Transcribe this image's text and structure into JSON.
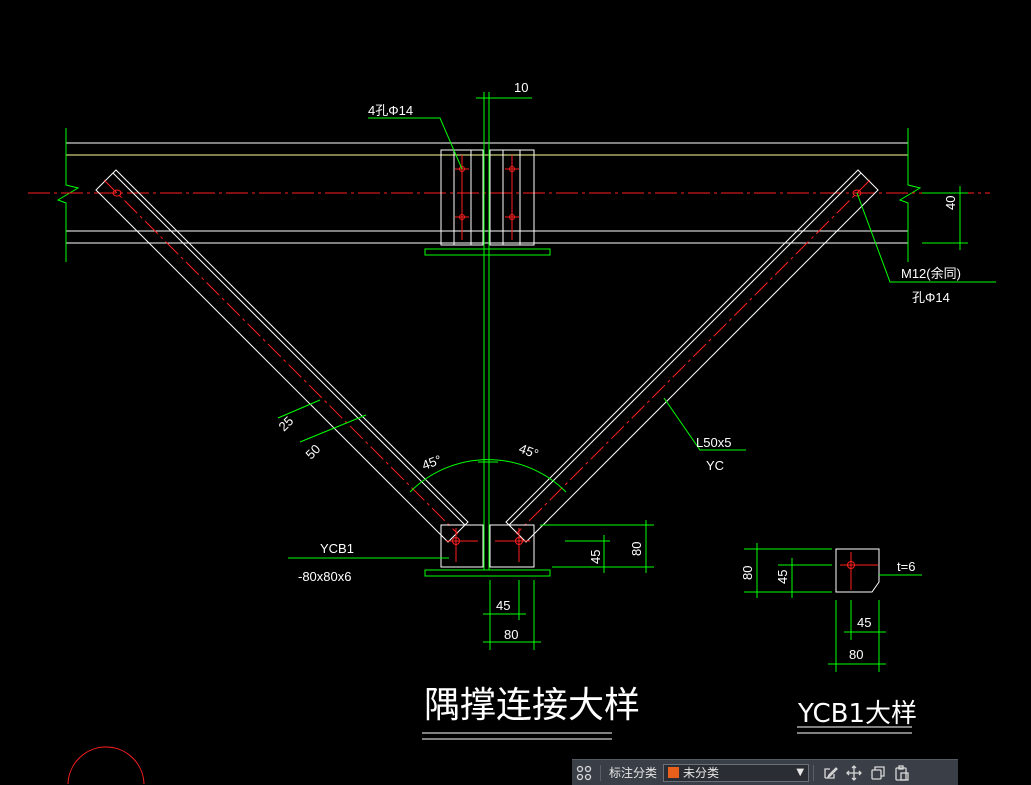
{
  "drawing": {
    "title_main": "隅撑连接大样",
    "title_detail": "YCB1大样",
    "labels": {
      "holes": "4孔Φ14",
      "gap": "10",
      "edge_40": "40",
      "bolt": "M12(余同)",
      "bolt_hole": "孔Φ14",
      "dim_25": "25",
      "dim_50": "50",
      "angle_left": "45°",
      "angle_right": "45°",
      "angle_section": "L50x5",
      "angle_code": "YC",
      "plate_code": "YCB1",
      "plate_size": "-80x80x6",
      "dim_45_v": "45",
      "dim_80_v": "80",
      "dim_45_h": "45",
      "dim_80_h": "80",
      "detail_80_v": "80",
      "detail_45_v": "45",
      "detail_thickness": "t=6",
      "detail_45_h": "45",
      "detail_80_h": "80"
    },
    "colors": {
      "outline": "#ffffff",
      "dim": "#00ff00",
      "center": "#ff2020",
      "flange": "#ffff99"
    }
  },
  "toolbar": {
    "grid_icon": "grid-icon",
    "category_label": "标注分类",
    "category_value": "未分类",
    "category_color": "#e8601c",
    "icons": [
      "edit-icon",
      "move-icon",
      "copy-icon",
      "paste-icon"
    ]
  }
}
